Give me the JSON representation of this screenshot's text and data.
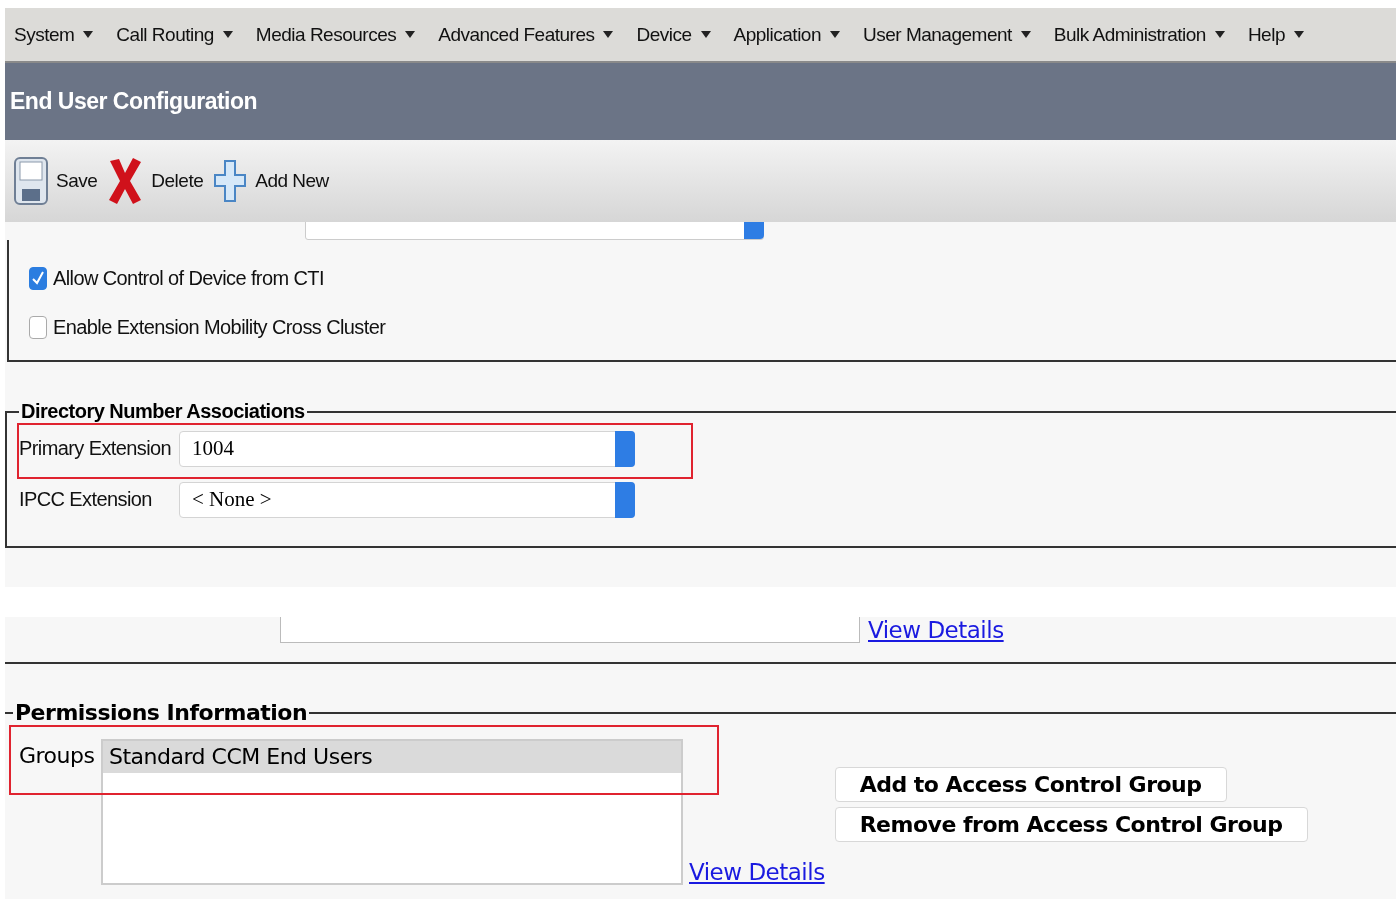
{
  "menu": [
    {
      "label": "System"
    },
    {
      "label": "Call Routing"
    },
    {
      "label": "Media Resources"
    },
    {
      "label": "Advanced Features"
    },
    {
      "label": "Device"
    },
    {
      "label": "Application"
    },
    {
      "label": "User Management"
    },
    {
      "label": "Bulk Administration"
    },
    {
      "label": "Help"
    }
  ],
  "page_title": "End User Configuration",
  "toolbar": [
    {
      "kind": "save",
      "label": "Save"
    },
    {
      "kind": "delete",
      "label": "Delete"
    },
    {
      "kind": "add",
      "label": "Add New"
    }
  ],
  "options": [
    {
      "label": "Allow Control of Device from CTI",
      "checked": true
    },
    {
      "label": "Enable Extension Mobility Cross Cluster",
      "checked": false
    }
  ],
  "directory": {
    "legend": "Directory Number Associations",
    "fields": [
      {
        "label": "Primary Extension",
        "value": "1004",
        "highlighted": true
      },
      {
        "label": "IPCC Extension",
        "value": "< None >",
        "highlighted": false
      }
    ]
  },
  "mobility": {
    "link": "View Details"
  },
  "permissions": {
    "legend": "Permissions Information",
    "groups_label": "Groups",
    "highlighted": true,
    "groups": [
      {
        "name": "Standard CCM End Users",
        "selected": true
      }
    ],
    "buttons": [
      "Add to Access Control Group",
      "Remove from Access Control Group"
    ],
    "link": "View Details"
  }
}
